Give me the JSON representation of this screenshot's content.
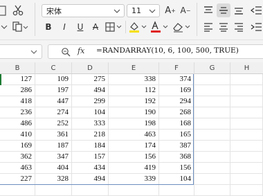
{
  "ribbon": {
    "font_name": "宋体",
    "font_size": "11",
    "increase_font_label": "A",
    "decrease_font_label": "A",
    "bold_label": "B",
    "italic_label": "I",
    "underline_label": "U",
    "strike_label": "A",
    "fill_color": "#f5e000",
    "font_color": "#e02020"
  },
  "formula_bar": {
    "fx_label": "fx",
    "formula": "=RANDARRAY(10, 6, 100, 500, TRUE)"
  },
  "sheet": {
    "columns": [
      "B",
      "C",
      "D",
      "E",
      "F",
      "G",
      "H"
    ],
    "rows": [
      [
        "127",
        "109",
        "275",
        "338",
        "374"
      ],
      [
        "286",
        "197",
        "494",
        "112",
        "169"
      ],
      [
        "418",
        "447",
        "299",
        "192",
        "294"
      ],
      [
        "236",
        "274",
        "104",
        "190",
        "268"
      ],
      [
        "486",
        "252",
        "333",
        "198",
        "168"
      ],
      [
        "410",
        "361",
        "218",
        "463",
        "165"
      ],
      [
        "169",
        "187",
        "184",
        "174",
        "387"
      ],
      [
        "362",
        "347",
        "157",
        "156",
        "368"
      ],
      [
        "463",
        "404",
        "434",
        "419",
        "156"
      ],
      [
        "227",
        "328",
        "494",
        "339",
        "104"
      ]
    ]
  }
}
